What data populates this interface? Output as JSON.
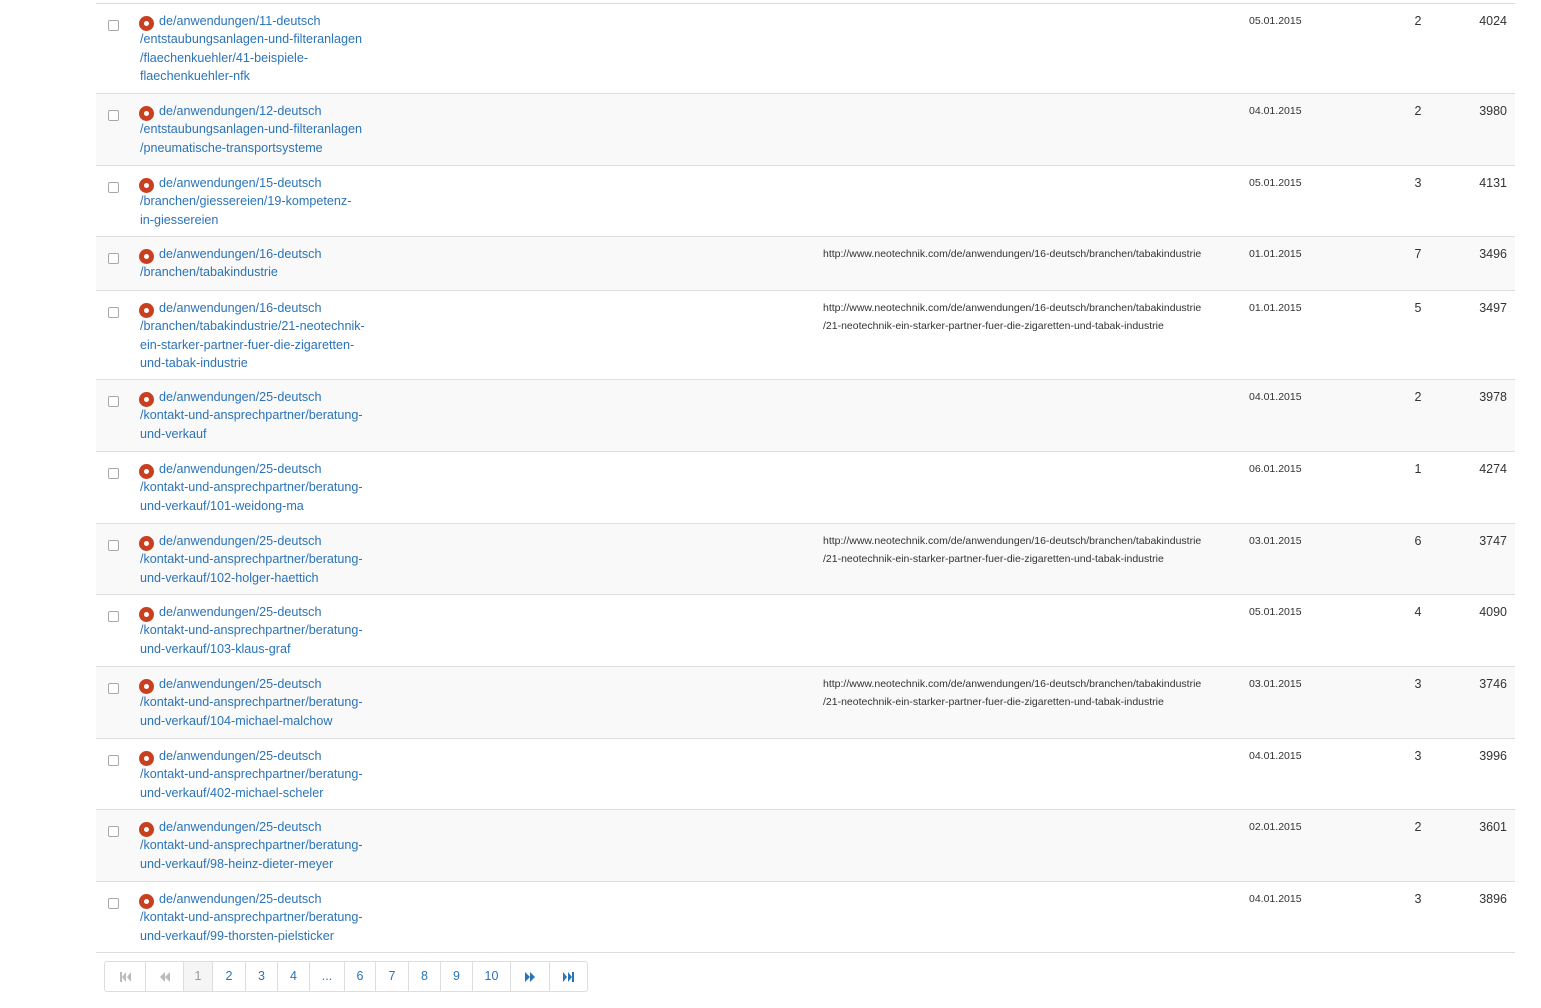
{
  "rows": [
    {
      "url": "de/anwendungen/11-deutsch\n/entstaubungsanlagen-und-filteranlagen\n/flaechenkuehler/41-beispiele-\nflaechenkuehler-nfk",
      "referrer": "",
      "date": "05.01.2015",
      "count": "2",
      "id": "4024"
    },
    {
      "url": "de/anwendungen/12-deutsch\n/entstaubungsanlagen-und-filteranlagen\n/pneumatische-transportsysteme",
      "referrer": "",
      "date": "04.01.2015",
      "count": "2",
      "id": "3980"
    },
    {
      "url": "de/anwendungen/15-deutsch\n/branchen/giessereien/19-kompetenz-\nin-giessereien",
      "referrer": "",
      "date": "05.01.2015",
      "count": "3",
      "id": "4131"
    },
    {
      "url": "de/anwendungen/16-deutsch\n/branchen/tabakindustrie",
      "referrer": "http://www.neotechnik.com/de/anwendungen/16-deutsch/branchen/tabakindustrie",
      "date": "01.01.2015",
      "count": "7",
      "id": "3496"
    },
    {
      "url": "de/anwendungen/16-deutsch\n/branchen/tabakindustrie/21-neotechnik-\nein-starker-partner-fuer-die-zigaretten-\nund-tabak-industrie",
      "referrer": "http://www.neotechnik.com/de/anwendungen/16-deutsch/branchen/tabakindustrie\n/21-neotechnik-ein-starker-partner-fuer-die-zigaretten-und-tabak-industrie",
      "date": "01.01.2015",
      "count": "5",
      "id": "3497"
    },
    {
      "url": "de/anwendungen/25-deutsch\n/kontakt-und-ansprechpartner/beratung-\nund-verkauf",
      "referrer": "",
      "date": "04.01.2015",
      "count": "2",
      "id": "3978"
    },
    {
      "url": "de/anwendungen/25-deutsch\n/kontakt-und-ansprechpartner/beratung-\nund-verkauf/101-weidong-ma",
      "referrer": "",
      "date": "06.01.2015",
      "count": "1",
      "id": "4274"
    },
    {
      "url": "de/anwendungen/25-deutsch\n/kontakt-und-ansprechpartner/beratung-\nund-verkauf/102-holger-haettich",
      "referrer": "http://www.neotechnik.com/de/anwendungen/16-deutsch/branchen/tabakindustrie\n/21-neotechnik-ein-starker-partner-fuer-die-zigaretten-und-tabak-industrie",
      "date": "03.01.2015",
      "count": "6",
      "id": "3747"
    },
    {
      "url": "de/anwendungen/25-deutsch\n/kontakt-und-ansprechpartner/beratung-\nund-verkauf/103-klaus-graf",
      "referrer": "",
      "date": "05.01.2015",
      "count": "4",
      "id": "4090"
    },
    {
      "url": "de/anwendungen/25-deutsch\n/kontakt-und-ansprechpartner/beratung-\nund-verkauf/104-michael-malchow",
      "referrer": "http://www.neotechnik.com/de/anwendungen/16-deutsch/branchen/tabakindustrie\n/21-neotechnik-ein-starker-partner-fuer-die-zigaretten-und-tabak-industrie",
      "date": "03.01.2015",
      "count": "3",
      "id": "3746"
    },
    {
      "url": "de/anwendungen/25-deutsch\n/kontakt-und-ansprechpartner/beratung-\nund-verkauf/402-michael-scheler",
      "referrer": "",
      "date": "04.01.2015",
      "count": "3",
      "id": "3996"
    },
    {
      "url": "de/anwendungen/25-deutsch\n/kontakt-und-ansprechpartner/beratung-\nund-verkauf/98-heinz-dieter-meyer",
      "referrer": "",
      "date": "02.01.2015",
      "count": "2",
      "id": "3601"
    },
    {
      "url": "de/anwendungen/25-deutsch\n/kontakt-und-ansprechpartner/beratung-\nund-verkauf/99-thorsten-pielsticker",
      "referrer": "",
      "date": "04.01.2015",
      "count": "3",
      "id": "3896"
    }
  ],
  "pagination": {
    "first_icon": "first-page-icon",
    "prev_icon": "previous-page-icon",
    "pages": [
      "1",
      "2",
      "3",
      "4",
      "...",
      "6",
      "7",
      "8",
      "9",
      "10"
    ],
    "current": "1",
    "next_icon": "next-page-icon",
    "last_icon": "last-page-icon"
  },
  "colors": {
    "link": "#2b73b7",
    "status_icon": "#c8401f",
    "row_alt": "#f9f9f9"
  }
}
